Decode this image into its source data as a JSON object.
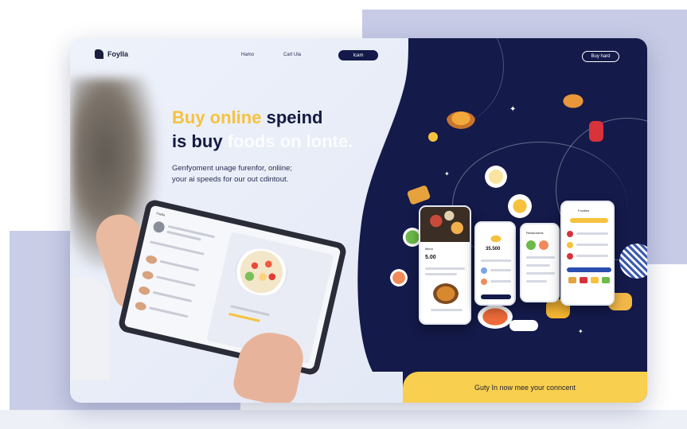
{
  "brand": {
    "name": "Foylla"
  },
  "nav": {
    "home": "Hamo",
    "cart": "Cart Ula",
    "cta": "Icam"
  },
  "header_button": "Buy hard",
  "hero": {
    "line1_yellow": "Buy online",
    "line1_dark": "speind",
    "line2_dark": "is buy",
    "line2_white": "foods on lonte.",
    "sub1": "Genfyoment unage furenfor, onliine;",
    "sub2": "your ai speeds for our out cdintout."
  },
  "phones": {
    "price": "5.00",
    "price2": "35.500"
  },
  "cta_bar": "Guty In now mee your conncent",
  "colors": {
    "navy": "#141a4a",
    "yellow": "#f8cf4e",
    "accent_yellow_text": "#f6c23e"
  }
}
